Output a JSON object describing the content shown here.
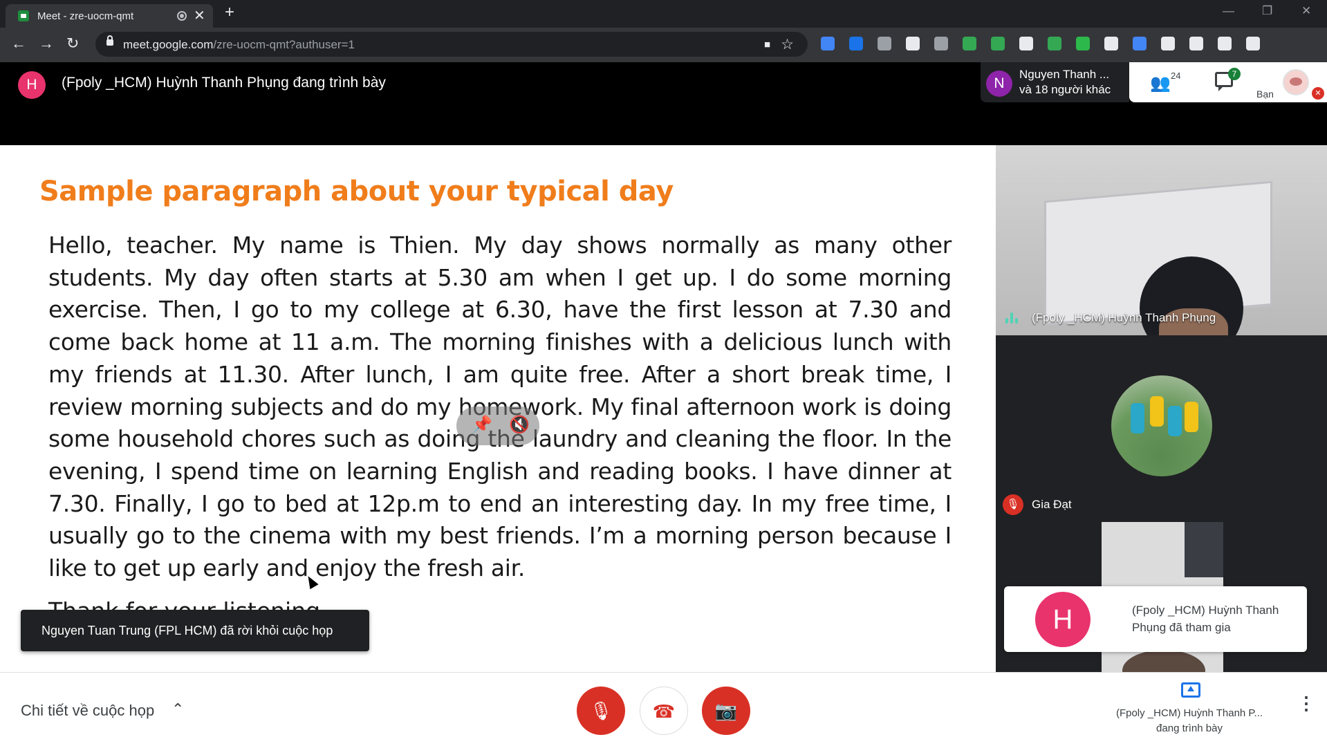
{
  "browser": {
    "tab_title": "Meet - zre-uocm-qmt",
    "tab_close": "✕",
    "new_tab": "+",
    "window_buttons": {
      "minimize": "—",
      "restore": "❐",
      "close": "✕"
    },
    "nav": {
      "back": "←",
      "forward": "→",
      "reload": "↻"
    },
    "url_host": "meet.google.com",
    "url_path": "/zre-uocm-qmt?authuser=1",
    "omnibox_icons": {
      "camera": "■",
      "star": "☆"
    },
    "extension_colors": [
      "#4285f4",
      "#1a73e8",
      "#9aa0a6",
      "#e8eaed",
      "#9aa0a6",
      "#34a853",
      "#34a853",
      "#e8eaed",
      "#34a853",
      "#2db84c",
      "#e8eaed",
      "#4285f4",
      "#e8eaed",
      "#e8eaed",
      "#e8eaed",
      "#e8eaed"
    ]
  },
  "meet_header": {
    "presenter_initial": "H",
    "presenter_title": "(Fpoly _HCM) Huỳnh Thanh Phụng đang trình bày",
    "speaker_initial": "N",
    "speaker_name": "Nguyen Thanh ...",
    "speaker_others": "và 18 người khác",
    "people_icon": "👥",
    "people_count": "24",
    "chat_badge": "7",
    "self_label": "Bạn",
    "self_muted_icon": "✕"
  },
  "slide": {
    "title": "Sample paragraph about your typical day",
    "body": "Hello, teacher. My name is Thien. My day shows normally as many other students. My day often starts at 5.30 am when I get up. I do some morning exercise. Then, I go to my college at 6.30, have the first lesson at 7.30 and come back home at 11 a.m. The morning finishes with a delicious lunch with my friends at 11.30. After lunch, I am quite free. After a short break time, I review morning subjects and do my homework. My final afternoon work is doing some household chores such as doing the laundry and cleaning the floor. In the evening, I spend time on learning English and reading books. I have dinner at 7.30. Finally, I go to bed at 12p.m to end an interesting day. In my free time, I usually go to the cinema with my best friends. I’m a morning person because I like to get up early and enjoy the fresh air.",
    "cut_off_line": "Thank for your listening",
    "overlay_pin_icon": "📌",
    "overlay_mute_icon": "🔇"
  },
  "toast": {
    "text": "Nguyen Tuan Trung (FPL HCM) đã rời khỏi cuộc họp"
  },
  "participants": {
    "tile1_name": "(Fpoly _HCM) Huỳnh Thanh Phụng",
    "tile2_mic_icon": "🎙",
    "tile2_name": "Gia Đạt",
    "join_initial": "H",
    "join_text": "(Fpoly _HCM) Huỳnh Thanh Phụng đã tham gia"
  },
  "bottom_bar": {
    "details_label": "Chi tiết về cuộc họp",
    "details_chevron": "⌃",
    "mic_icon": "🎙",
    "leave_icon": "☎",
    "camera_icon": "📷",
    "present_name": "(Fpoly _HCM) Huỳnh Thanh P...",
    "present_status": "đang trình bày",
    "more_icon": "⋮"
  },
  "colors": {
    "accent_red": "#d93025",
    "title_orange": "#f07d1b",
    "avatar_pink": "#e8336d",
    "avatar_purple": "#8e24aa",
    "badge_green": "#188038"
  }
}
